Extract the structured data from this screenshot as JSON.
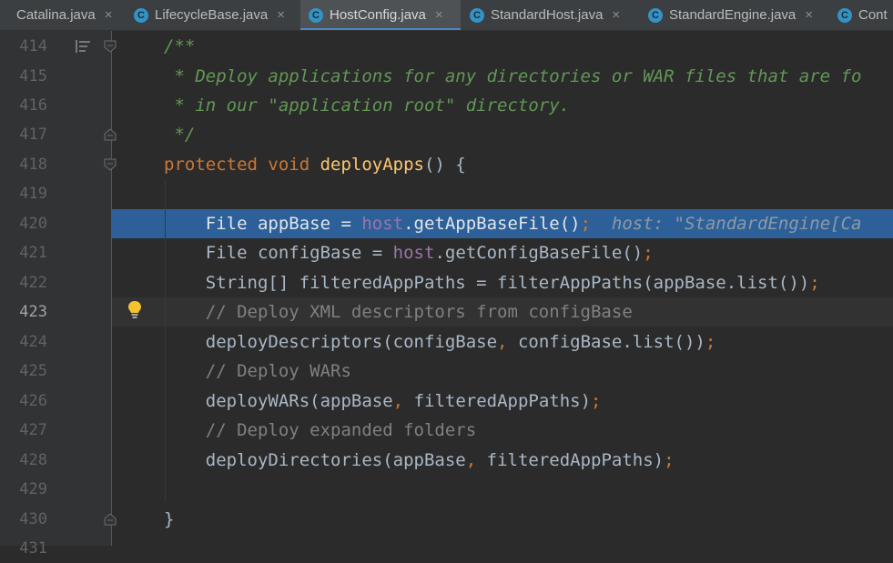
{
  "tabs": [
    {
      "label": "Catalina.java",
      "active": false
    },
    {
      "label": "LifecycleBase.java",
      "active": false
    },
    {
      "label": "HostConfig.java",
      "active": true
    },
    {
      "label": "StandardHost.java",
      "active": false
    },
    {
      "label": "StandardEngine.java",
      "active": false
    },
    {
      "label": "Cont",
      "active": false
    }
  ],
  "tab_icon_letter": "C",
  "tab_close_glyph": "×",
  "line_numbers": [
    "414",
    "415",
    "416",
    "417",
    "418",
    "419",
    "420",
    "421",
    "422",
    "423",
    "424",
    "425",
    "426",
    "427",
    "428",
    "429",
    "430",
    "431"
  ],
  "current_line": "423",
  "execution_line": "420",
  "code": {
    "l414": "/**",
    "l415": " * Deploy applications for any directories or WAR files that are fo",
    "l416": " * in our \"application root\" directory.",
    "l417": " */",
    "l418_kw": "protected void ",
    "l418_fn": "deployApps",
    "l418_rest": "() {",
    "l420_a": "    File appBase = ",
    "l420_host": "host",
    "l420_b": ".getAppBaseFile()",
    "l420_semi": ";",
    "l420_hint": "  host: \"StandardEngine[Ca",
    "l421_a": "    File configBase = ",
    "l421_host": "host",
    "l421_b": ".getConfigBaseFile()",
    "l421_semi": ";",
    "l422_a": "    String[] filteredAppPaths = filterAppPaths(appBase.list())",
    "l422_semi": ";",
    "l423": "    // Deploy XML descriptors from configBase",
    "l424_a": "    deployDescriptors(configBase",
    "l424_comma": ", ",
    "l424_b": "configBase.list())",
    "l424_semi": ";",
    "l425": "    // Deploy WARs",
    "l426_a": "    deployWARs(appBase",
    "l426_comma": ", ",
    "l426_b": "filteredAppPaths)",
    "l426_semi": ";",
    "l427": "    // Deploy expanded folders",
    "l428_a": "    deployDirectories(appBase",
    "l428_comma": ", ",
    "l428_b": "filteredAppPaths)",
    "l428_semi": ";",
    "l430": "}"
  },
  "colors": {
    "background": "#2b2b2b",
    "gutter": "#313335",
    "execution_highlight": "#2d6099",
    "keyword": "#cc7832",
    "method_decl": "#ffc66d",
    "field": "#9876aa",
    "doc_comment": "#629755",
    "comment": "#808080"
  },
  "icons": [
    "class-c-icon",
    "close-icon",
    "fold-marker-icon",
    "doc-render-icon",
    "intention-bulb-icon"
  ]
}
